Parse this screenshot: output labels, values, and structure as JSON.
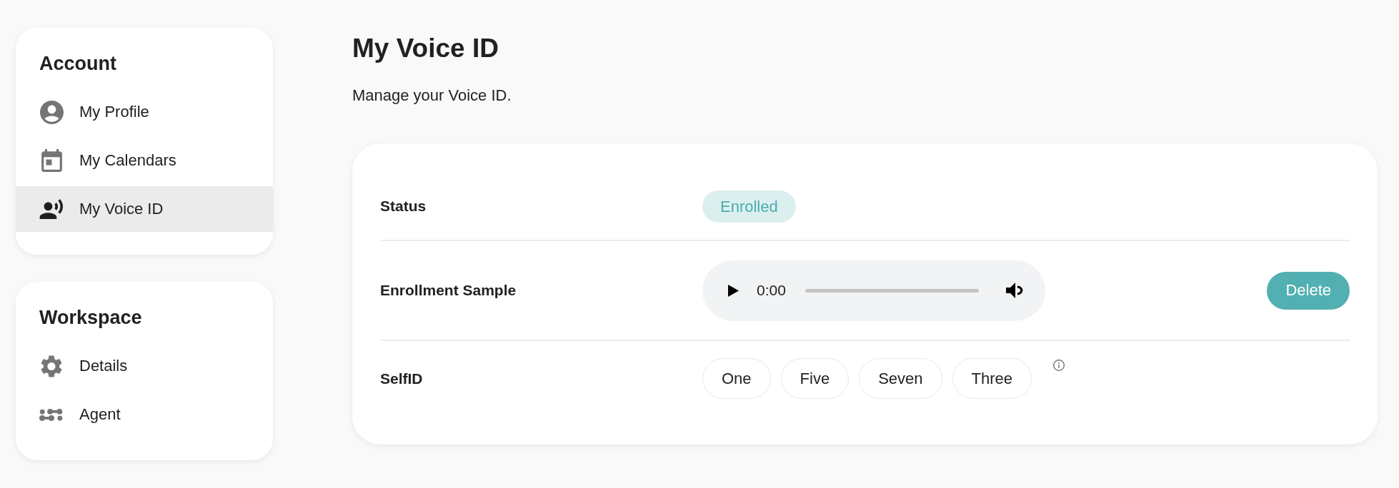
{
  "sidebar": {
    "sections": [
      {
        "title": "Account",
        "items": [
          {
            "label": "My Profile",
            "selected": false
          },
          {
            "label": "My Calendars",
            "selected": false
          },
          {
            "label": "My Voice ID",
            "selected": true
          }
        ]
      },
      {
        "title": "Workspace",
        "items": [
          {
            "label": "Details",
            "selected": false
          },
          {
            "label": "Agent",
            "selected": false
          }
        ]
      }
    ]
  },
  "page": {
    "title": "My Voice ID",
    "subtitle": "Manage your Voice ID."
  },
  "settings": {
    "rows": [
      {
        "kind": "status",
        "label": "Status",
        "badge": "Enrolled"
      },
      {
        "kind": "audio",
        "label": "Enrollment Sample",
        "player": {
          "time": "0:00"
        },
        "button": "Delete"
      },
      {
        "kind": "words",
        "label": "SelfID",
        "chips": [
          "One",
          "Five",
          "Seven",
          "Three"
        ]
      }
    ]
  }
}
